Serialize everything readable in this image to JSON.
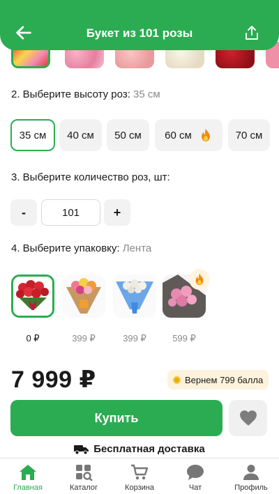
{
  "header": {
    "title": "Букет из 101 розы",
    "back_icon": "arrow-left-icon",
    "share_icon": "share-icon"
  },
  "height": {
    "label": "2. Выберите высоту роз:",
    "selected": "35 см",
    "options": [
      "35 см",
      "40 см",
      "50 см",
      "60 см",
      "70 см"
    ]
  },
  "quantity": {
    "label": "3. Выберите количество роз, шт:",
    "minus": "-",
    "value": "101",
    "plus": "+"
  },
  "packaging": {
    "label": "4. Выберите упаковку:",
    "selected": "Лента",
    "options": [
      {
        "price": "0 ₽"
      },
      {
        "price": "399 ₽"
      },
      {
        "price": "399 ₽"
      },
      {
        "price": "599 ₽"
      }
    ]
  },
  "price": "7 999 ₽",
  "bonus": "Вернем 799 балла",
  "buy_label": "Купить",
  "delivery_label": "Бесплатная доставка",
  "nav": {
    "items": [
      {
        "label": "Главная",
        "icon": "home-icon"
      },
      {
        "label": "Каталог",
        "icon": "catalog-icon"
      },
      {
        "label": "Корзина",
        "icon": "cart-icon"
      },
      {
        "label": "Чат",
        "icon": "chat-icon"
      },
      {
        "label": "Профиль",
        "icon": "profile-icon"
      }
    ]
  },
  "colors": {
    "accent": "#2bac52",
    "bonus_bg": "#fdf3dc"
  }
}
